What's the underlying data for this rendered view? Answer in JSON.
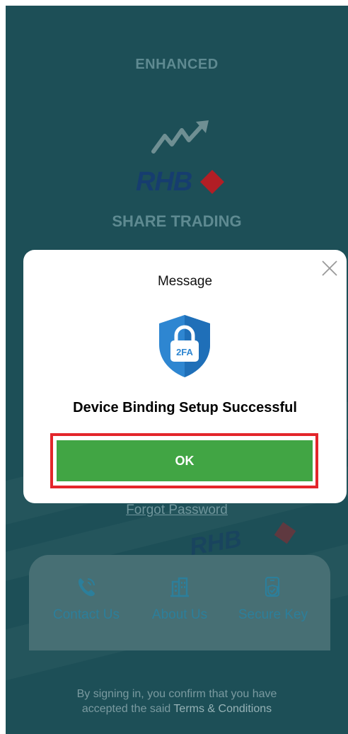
{
  "header": {
    "edition_label": "ENHANCED",
    "brand": "RHB",
    "product_name": "SHARE TRADING"
  },
  "dialog": {
    "title": "Message",
    "shield_badge": "2FA",
    "message": "Device Binding Setup Successful",
    "ok_label": "OK",
    "close_icon": "close-icon"
  },
  "login": {
    "forgot_password_label": "Forgot Password"
  },
  "quick_actions": [
    {
      "label": "Contact Us",
      "icon": "phone-icon"
    },
    {
      "label": "About Us",
      "icon": "building-icon"
    },
    {
      "label": "Secure Key",
      "icon": "secure-key-icon"
    }
  ],
  "footer": {
    "consent_text_line1": "By signing in, you confirm that you have",
    "consent_text_line2": "accepted the said",
    "terms_link": "Terms & Conditions"
  },
  "colors": {
    "background": "#1d4f57",
    "ok_button": "#41a544",
    "highlight_border": "#e3262b",
    "brand_blue": "#163d6f",
    "brand_red": "#b21e25"
  }
}
